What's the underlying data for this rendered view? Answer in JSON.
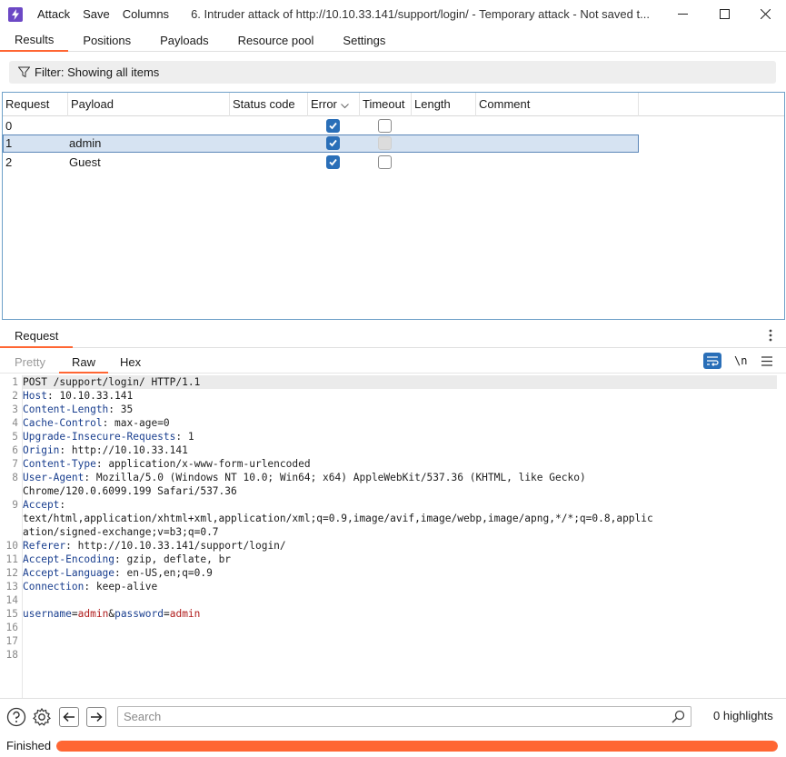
{
  "titlebar": {
    "menu": [
      "Attack",
      "Save",
      "Columns"
    ],
    "title": "6. Intruder attack of http://10.10.33.141/support/login/ - Temporary attack - Not saved t..."
  },
  "tabs": [
    "Results",
    "Positions",
    "Payloads",
    "Resource pool",
    "Settings"
  ],
  "active_tab": "Results",
  "filter": {
    "label": "Filter: Showing all items",
    "icon": "funnel-icon"
  },
  "results_table": {
    "columns": [
      "Request",
      "Payload",
      "Status code",
      "Error",
      "Timeout",
      "Length",
      "Comment"
    ],
    "sort_column": "Error",
    "rows": [
      {
        "request": "0",
        "payload": "",
        "status_code": "",
        "error": true,
        "timeout": false,
        "timeout_disabled": false,
        "length": "",
        "comment": ""
      },
      {
        "request": "1",
        "payload": "admin",
        "status_code": "",
        "error": true,
        "timeout": false,
        "timeout_disabled": true,
        "length": "",
        "comment": "",
        "selected": true
      },
      {
        "request": "2",
        "payload": "Guest",
        "status_code": "",
        "error": true,
        "timeout": false,
        "timeout_disabled": false,
        "length": "",
        "comment": ""
      }
    ]
  },
  "request_panel": {
    "tab": "Request",
    "view_tabs": [
      "Pretty",
      "Raw",
      "Hex"
    ],
    "active_view": "Raw",
    "toolbar": {
      "newline_label": "\\n"
    },
    "lines": [
      {
        "n": "1",
        "text": "POST /support/login/ HTTP/1.1"
      },
      {
        "n": "2",
        "key": "Host",
        "value": " 10.10.33.141"
      },
      {
        "n": "3",
        "key": "Content-Length",
        "value": " 35"
      },
      {
        "n": "4",
        "key": "Cache-Control",
        "value": " max-age=0"
      },
      {
        "n": "5",
        "key": "Upgrade-Insecure-Requests",
        "value": " 1"
      },
      {
        "n": "6",
        "key": "Origin",
        "value": " http://10.10.33.141"
      },
      {
        "n": "7",
        "key": "Content-Type",
        "value": " application/x-www-form-urlencoded"
      },
      {
        "n": "8",
        "key": "User-Agent",
        "value": " Mozilla/5.0 (Windows NT 10.0; Win64; x64) AppleWebKit/537.36 (KHTML, like Gecko)"
      },
      {
        "n": "",
        "text": "Chrome/120.0.6099.199 Safari/537.36"
      },
      {
        "n": "9",
        "key": "Accept",
        "value": ""
      },
      {
        "n": "",
        "text": "text/html,application/xhtml+xml,application/xml;q=0.9,image/avif,image/webp,image/apng,*/*;q=0.8,applic"
      },
      {
        "n": "",
        "text": "ation/signed-exchange;v=b3;q=0.7"
      },
      {
        "n": "10",
        "key": "Referer",
        "value": " http://10.10.33.141/support/login/"
      },
      {
        "n": "11",
        "key": "Accept-Encoding",
        "value": " gzip, deflate, br"
      },
      {
        "n": "12",
        "key": "Accept-Language",
        "value": " en-US,en;q=0.9"
      },
      {
        "n": "13",
        "key": "Connection",
        "value": " keep-alive"
      },
      {
        "n": "14",
        "text": ""
      },
      {
        "n": "15",
        "body": [
          {
            "k": "username",
            "v": "admin"
          },
          {
            "k": "password",
            "v": "admin"
          }
        ]
      },
      {
        "n": "16",
        "text": ""
      },
      {
        "n": "17",
        "text": ""
      },
      {
        "n": "18",
        "text": ""
      }
    ]
  },
  "bottombar": {
    "search_placeholder": "Search",
    "highlights": "0 highlights"
  },
  "status": {
    "label": "Finished",
    "progress": 1.0
  },
  "colors": {
    "accent": "#ff6633",
    "selection": "#d6e3f2",
    "checkbox": "#2a6fb8"
  }
}
